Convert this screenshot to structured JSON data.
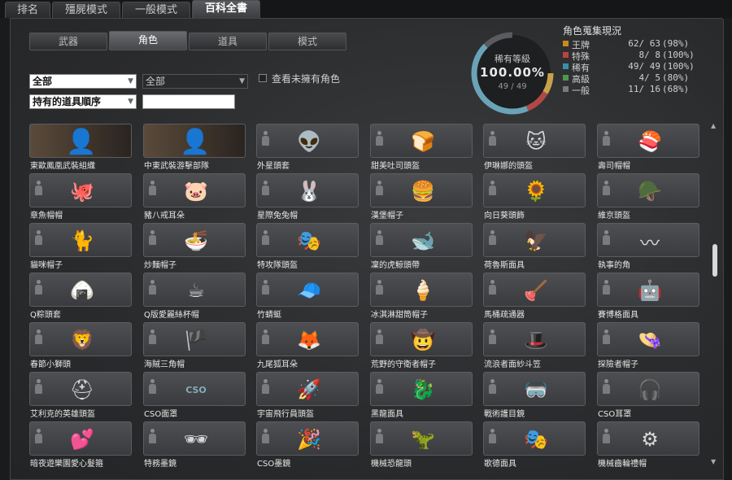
{
  "top_tabs": [
    "排名",
    "殭屍模式",
    "一般模式",
    "百科全書"
  ],
  "sub_tabs": [
    "武器",
    "角色",
    "道具",
    "模式"
  ],
  "filters": {
    "category_selected": "全部",
    "subcategory_selected": "全部",
    "sort_selected": "持有的道具順序",
    "search_value": "",
    "show_unowned_label": "查看未擁有角色"
  },
  "rarity": {
    "title": "稀有等級",
    "percent": "100.00%",
    "count": "49 / 49"
  },
  "collection": {
    "title": "角色蒐集現況",
    "rows": [
      {
        "label": "王牌",
        "count": "62/ 63",
        "pct": "(98%)",
        "color": "#c98a1c"
      },
      {
        "label": "特殊",
        "count": "8/ 8",
        "pct": "(100%)",
        "color": "#c04040"
      },
      {
        "label": "稀有",
        "count": "49/ 49",
        "pct": "(100%)",
        "color": "#3a8fa8"
      },
      {
        "label": "高級",
        "count": "4/ 5",
        "pct": "(80%)",
        "color": "#4a9a4a"
      },
      {
        "label": "一般",
        "count": "11/ 16",
        "pct": "(68%)",
        "color": "#7a7a7a"
      }
    ]
  },
  "items": [
    {
      "name": "東歐鳳凰武裝組織",
      "icon": "soldier-portrait",
      "symbol": "👤",
      "photo": true
    },
    {
      "name": "中東武裝游擊部隊",
      "icon": "soldier-portrait",
      "symbol": "👤",
      "photo": true
    },
    {
      "name": "外星頭套",
      "icon": "alien-head",
      "symbol": "👽"
    },
    {
      "name": "甜美吐司頭盔",
      "icon": "toast-head",
      "symbol": "🍞"
    },
    {
      "name": "伊琳娜的頭盔",
      "icon": "cat-helmet",
      "symbol": "🐱"
    },
    {
      "name": "壽司帽帽",
      "icon": "sushi-hat",
      "symbol": "🍣"
    },
    {
      "name": "章魚帽帽",
      "icon": "octopus-hat",
      "symbol": "🐙"
    },
    {
      "name": "豬八戒耳朵",
      "icon": "pig-ears",
      "symbol": "🐷"
    },
    {
      "name": "星際兔兔帽",
      "icon": "bunny-hat",
      "symbol": "🐰"
    },
    {
      "name": "漢堡帽子",
      "icon": "burger-hat",
      "symbol": "🍔"
    },
    {
      "name": "向日葵頭飾",
      "icon": "sunflower",
      "symbol": "🌻"
    },
    {
      "name": "維京頭盔",
      "icon": "viking-helmet",
      "symbol": "🪖"
    },
    {
      "name": "貓咪帽子",
      "icon": "cat-hat",
      "symbol": "🐈"
    },
    {
      "name": "炒麵帽子",
      "icon": "noodle-hat",
      "symbol": "🍜"
    },
    {
      "name": "特攻隊頭盔",
      "icon": "ranger-mask",
      "symbol": "🎭"
    },
    {
      "name": "凜的虎鯨頭帶",
      "icon": "orca-headband",
      "symbol": "🐋"
    },
    {
      "name": "荷魯斯面具",
      "icon": "horus-mask",
      "symbol": "🦅"
    },
    {
      "name": "執事的角",
      "icon": "horns",
      "symbol": "〰"
    },
    {
      "name": "Q粽頭套",
      "icon": "zongzi",
      "symbol": "🍙"
    },
    {
      "name": "Q版愛麗絲杯帽",
      "icon": "teacup-hat",
      "symbol": "☕"
    },
    {
      "name": "竹蜻蜓",
      "icon": "propeller-cap",
      "symbol": "🧢"
    },
    {
      "name": "冰淇淋甜筒帽子",
      "icon": "icecream-hat",
      "symbol": "🍦"
    },
    {
      "name": "馬桶疏通器",
      "icon": "plunger",
      "symbol": "🪠"
    },
    {
      "name": "賽博格面具",
      "icon": "cyborg-mask",
      "symbol": "🤖"
    },
    {
      "name": "春節小獅頭",
      "icon": "lion-head",
      "symbol": "🦁"
    },
    {
      "name": "海賊三角帽",
      "icon": "pirate-hat",
      "symbol": "🏴"
    },
    {
      "name": "九尾狐耳朵",
      "icon": "fox-ears",
      "symbol": "🦊"
    },
    {
      "name": "荒野的守衛者帽子",
      "icon": "cowboy-hat",
      "symbol": "🤠"
    },
    {
      "name": "流浪者面紗斗笠",
      "icon": "veil-hat",
      "symbol": "🎩"
    },
    {
      "name": "探險者帽子",
      "icon": "explorer-hat",
      "symbol": "👒"
    },
    {
      "name": "艾利克的英雄頭盔",
      "icon": "hero-helmet",
      "symbol": "⛑"
    },
    {
      "name": "CSO面罩",
      "icon": "cso-mask",
      "symbol": "CSO"
    },
    {
      "name": "宇宙飛行員頭盔",
      "icon": "astronaut-helmet",
      "symbol": "🚀"
    },
    {
      "name": "黑龍面具",
      "icon": "dragon-mask",
      "symbol": "🐉"
    },
    {
      "name": "戰術護目鏡",
      "icon": "tactical-goggles",
      "symbol": "🥽"
    },
    {
      "name": "CSO耳罩",
      "icon": "earmuffs",
      "symbol": "🎧"
    },
    {
      "name": "暗夜遊樂園愛心髮箍",
      "icon": "heart-headband",
      "symbol": "💕"
    },
    {
      "name": "特務墨鏡",
      "icon": "agent-sunglasses",
      "symbol": "🕶"
    },
    {
      "name": "CSO墨鏡",
      "icon": "party-glasses",
      "symbol": "🎉"
    },
    {
      "name": "機械恐龍頭",
      "icon": "mecha-dino",
      "symbol": "🦖"
    },
    {
      "name": "歌德面具",
      "icon": "gothic-mask",
      "symbol": "🎭"
    },
    {
      "name": "機械齒輪禮帽",
      "icon": "gear-tophat",
      "symbol": "⚙"
    }
  ]
}
